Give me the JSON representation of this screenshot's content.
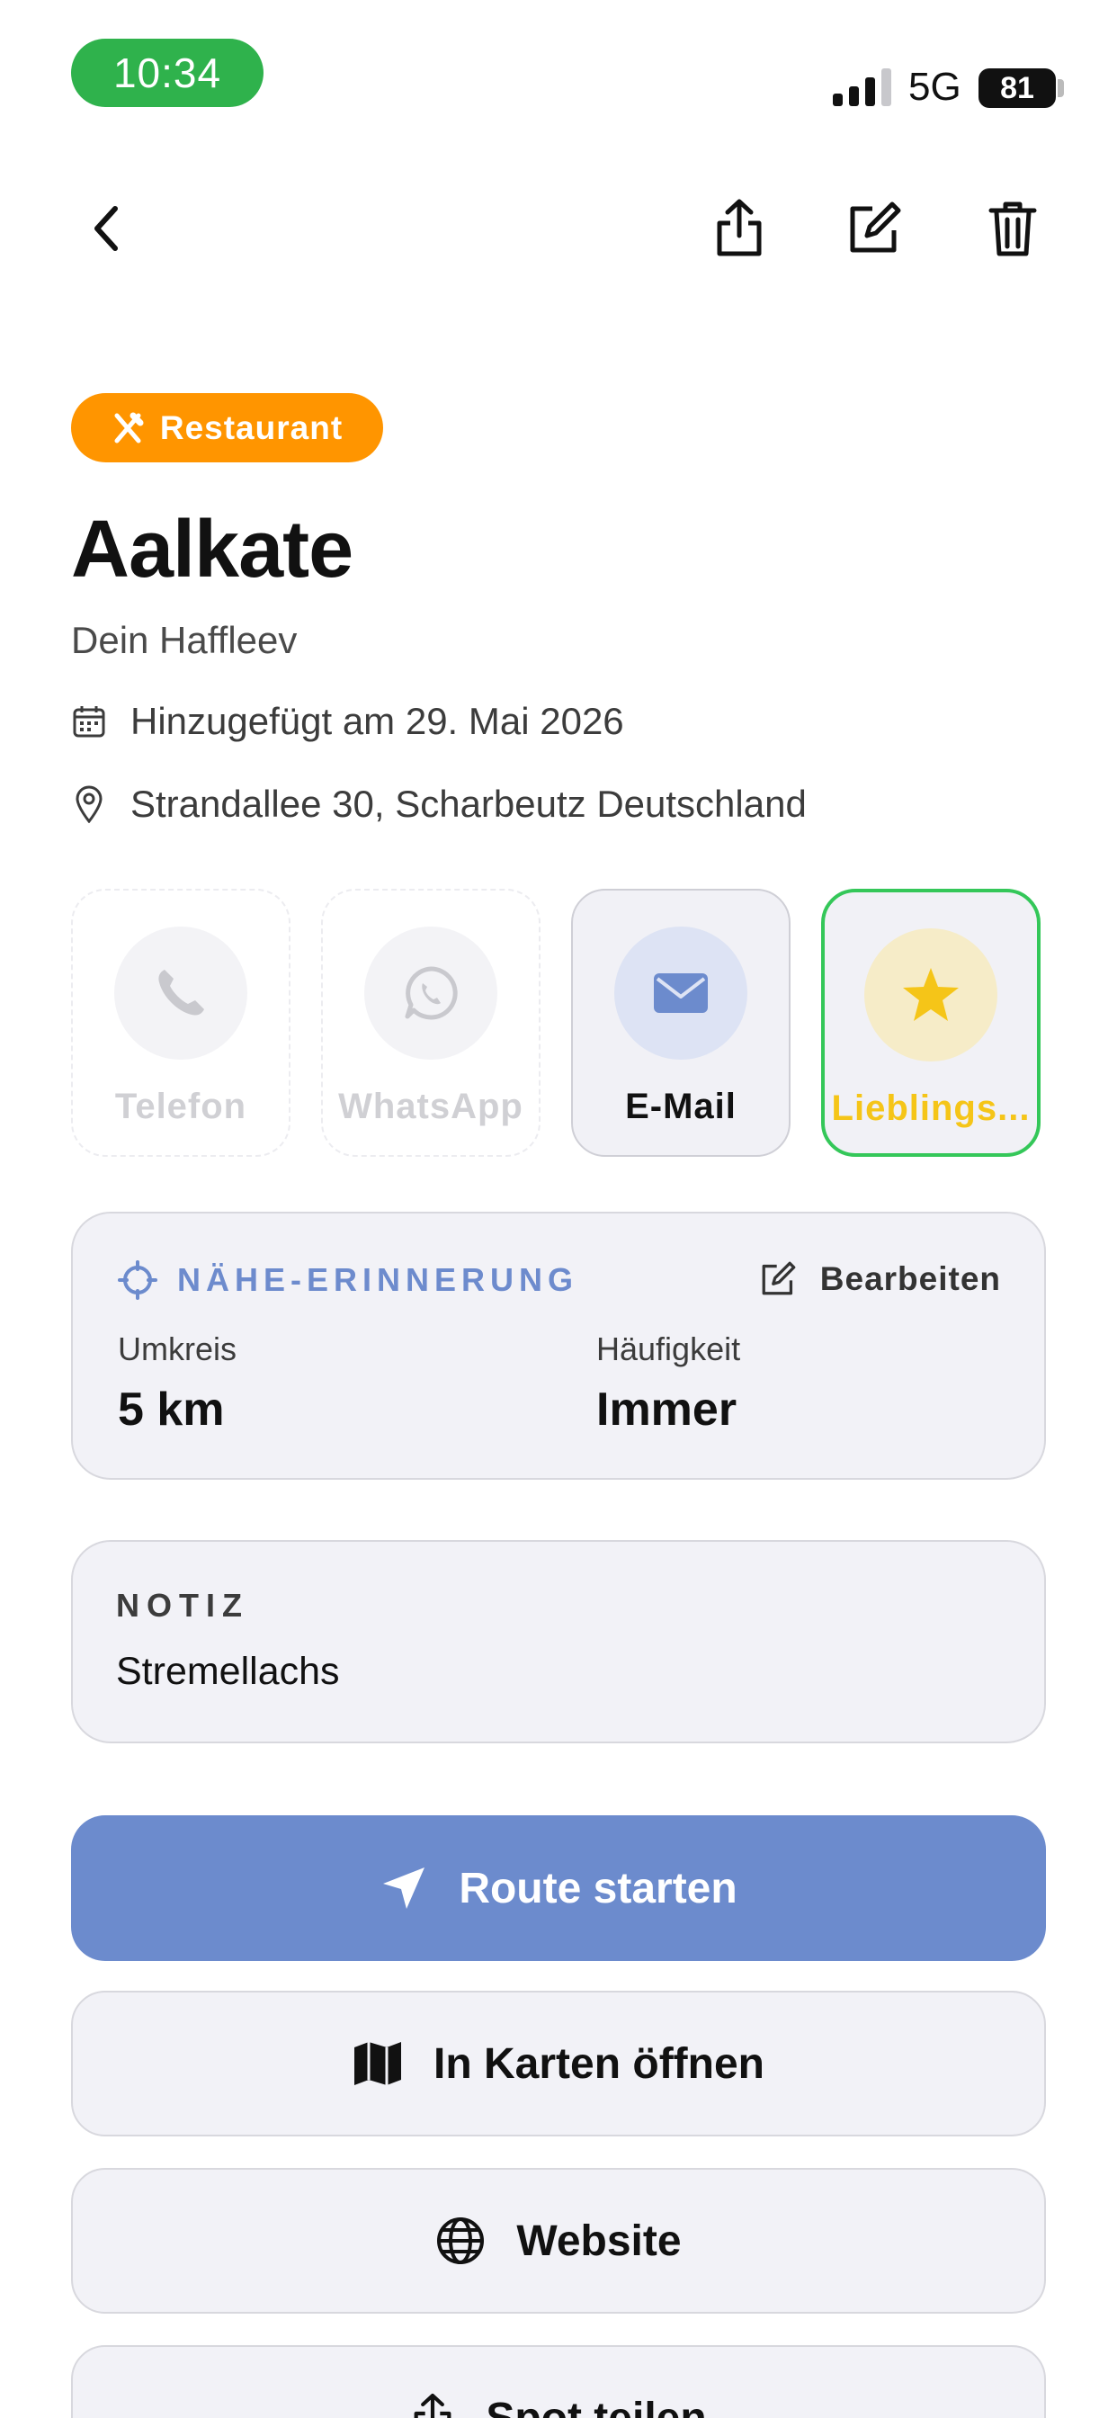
{
  "status_bar": {
    "time": "10:34",
    "network": "5G",
    "battery": "81",
    "time_pill_color": "#2fb24c"
  },
  "nav": {
    "icons": [
      "back-chevron-icon",
      "share-icon",
      "edit-icon",
      "trash-icon"
    ]
  },
  "place": {
    "category": "Restaurant",
    "category_color": "#ff9500",
    "category_icon": "fork-knife-icon",
    "name": "Aalkate",
    "subtitle": "Dein Haffleev",
    "added": "Hinzugefügt am 29. Mai 2026",
    "address": "Strandallee 30, Scharbeutz Deutschland"
  },
  "actions": [
    {
      "label": "Telefon",
      "icon": "phone-icon",
      "enabled": false
    },
    {
      "label": "WhatsApp",
      "icon": "whatsapp-icon",
      "enabled": false
    },
    {
      "label": "E-Mail",
      "icon": "mail-icon",
      "enabled": true
    },
    {
      "label": "Lieblings...",
      "icon": "star-icon",
      "enabled": true,
      "active": true
    }
  ],
  "reminder": {
    "heading": "NÄHE-ERINNERUNG",
    "edit_label": "Bearbeiten",
    "radius_label": "Umkreis",
    "radius_value": "5 km",
    "frequency_label": "Häufigkeit",
    "frequency_value": "Immer",
    "accent_color": "#6c8bcd"
  },
  "note": {
    "heading": "NOTIZ",
    "text": "Stremellachs"
  },
  "buttons": {
    "route": "Route starten",
    "maps": "In Karten öffnen",
    "website": "Website",
    "share": "Spot teilen"
  }
}
